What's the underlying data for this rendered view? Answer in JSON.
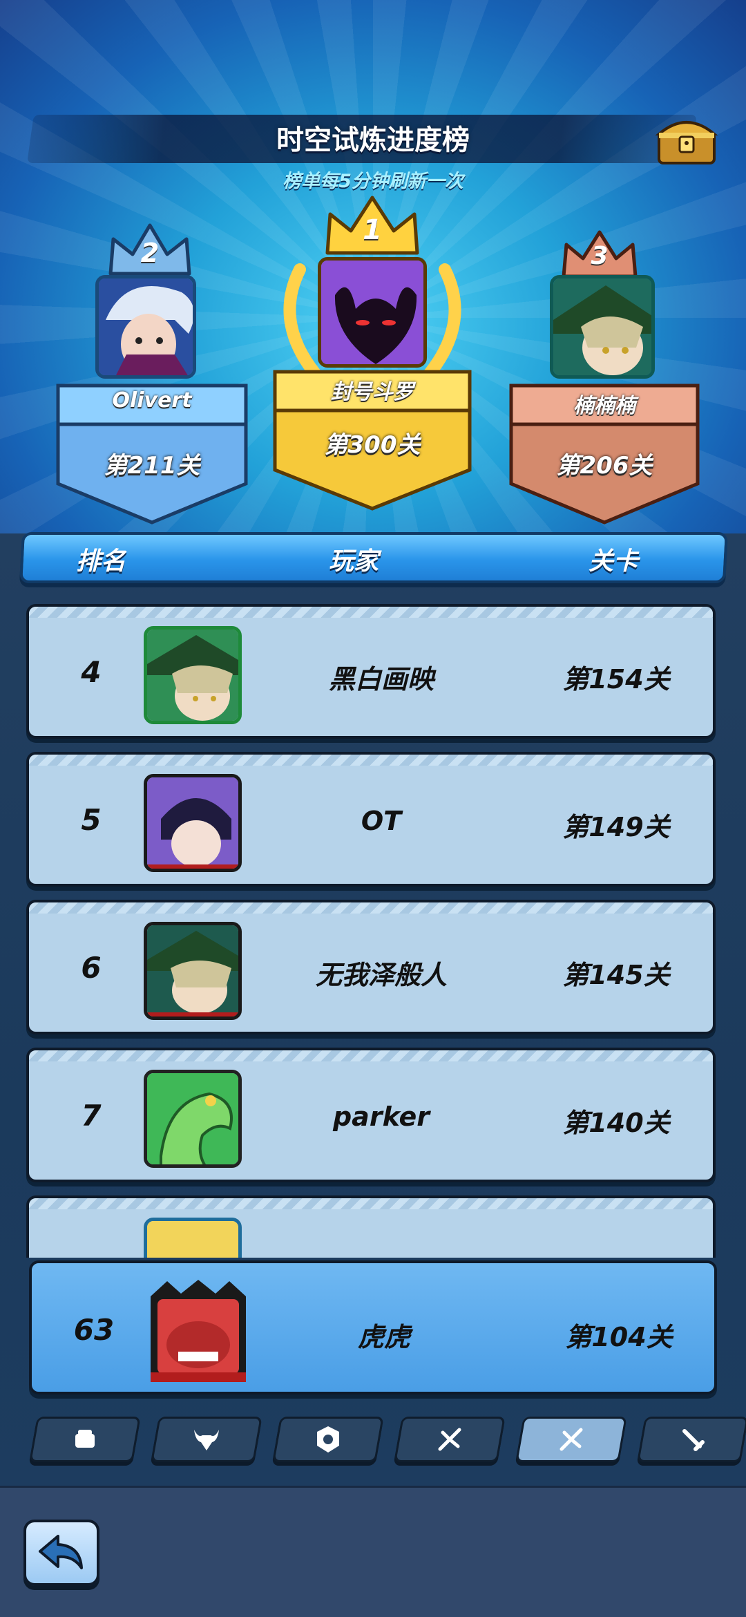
{
  "header": {
    "title": "时空试炼进度榜",
    "subtitle": "榜单每5分钟刷新一次"
  },
  "podium": [
    {
      "rank": "2",
      "name": "Olivert",
      "level": "第211关",
      "color": "#5aa9ee"
    },
    {
      "rank": "1",
      "name": "封号斗罗",
      "level": "第300关",
      "color": "#f6c93a"
    },
    {
      "rank": "3",
      "name": "楠楠楠",
      "level": "第206关",
      "color": "#d48a6d"
    }
  ],
  "columns": {
    "rank": "排名",
    "player": "玩家",
    "level": "关卡"
  },
  "rows": [
    {
      "rank": "4",
      "name": "黑白画映",
      "level": "第154关"
    },
    {
      "rank": "5",
      "name": "OT",
      "level": "第149关"
    },
    {
      "rank": "6",
      "name": "无我泽般人",
      "level": "第145关"
    },
    {
      "rank": "7",
      "name": "parker",
      "level": "第140关"
    }
  ],
  "self": {
    "rank": "63",
    "name": "虎虎",
    "level": "第104关"
  },
  "tabs": [
    {
      "icon": "fist-icon"
    },
    {
      "icon": "bull-head-icon"
    },
    {
      "icon": "shield-icon"
    },
    {
      "icon": "branch-icon"
    },
    {
      "icon": "branch-active-icon",
      "active": true
    },
    {
      "icon": "sword-icon"
    }
  ],
  "footer": {
    "back_icon": "back-arrow-icon"
  }
}
